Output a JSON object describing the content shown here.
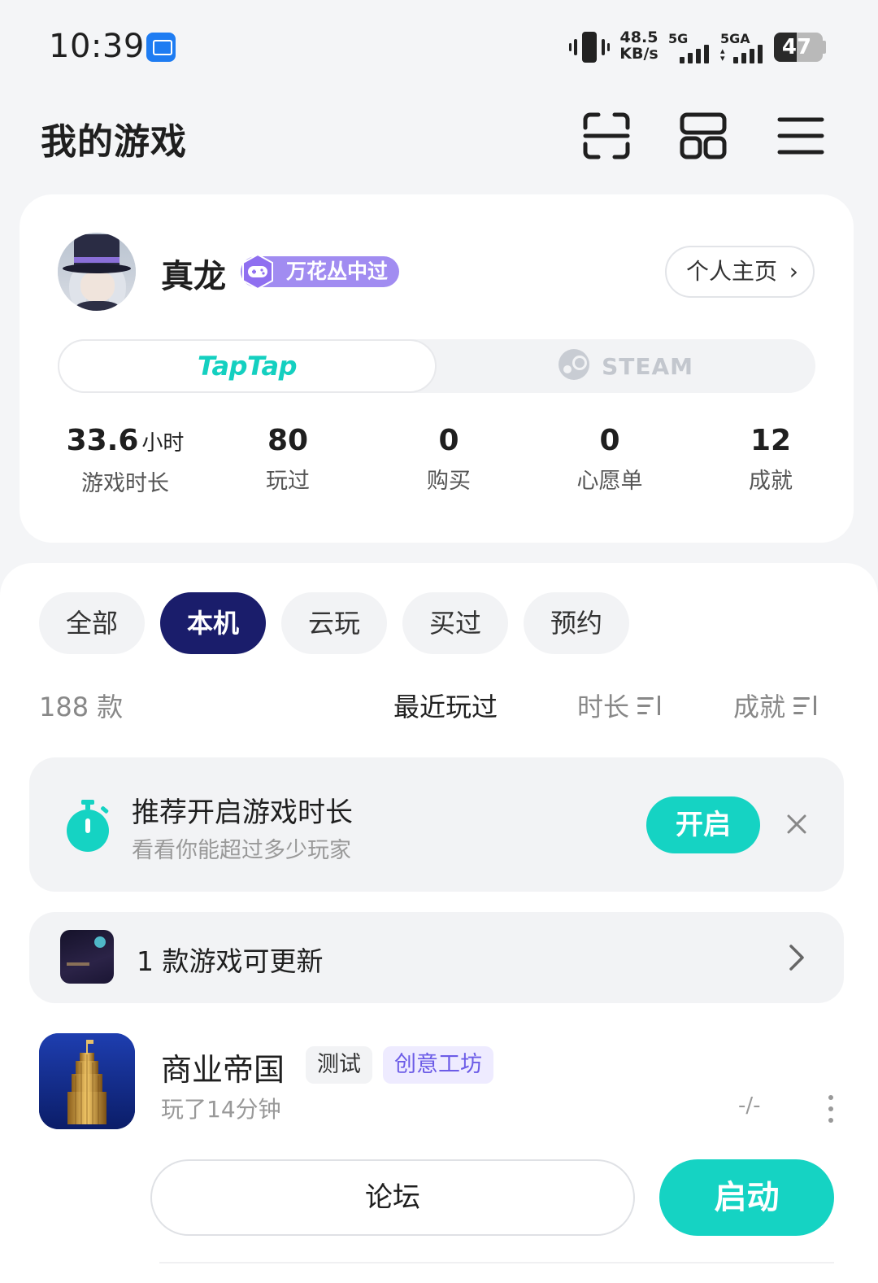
{
  "status_bar": {
    "time": "10:39",
    "net_speed_value": "48.5",
    "net_speed_unit": "KB/s",
    "signal1_label": "5G",
    "signal2_label": "5GA",
    "battery": "47"
  },
  "header": {
    "title": "我的游戏"
  },
  "profile": {
    "username": "真龙",
    "badge": "万花丛中过",
    "home_button": "个人主页",
    "platforms": [
      "TapTap",
      "STEAM"
    ],
    "active_platform": "TapTap",
    "stats": [
      {
        "value": "33.6",
        "unit": "小时",
        "label": "游戏时长"
      },
      {
        "value": "80",
        "unit": "",
        "label": "玩过"
      },
      {
        "value": "0",
        "unit": "",
        "label": "购买"
      },
      {
        "value": "0",
        "unit": "",
        "label": "心愿单"
      },
      {
        "value": "12",
        "unit": "",
        "label": "成就"
      }
    ]
  },
  "filters": {
    "chips": [
      "全部",
      "本机",
      "云玩",
      "买过",
      "预约"
    ],
    "active": "本机"
  },
  "list": {
    "count": "188 款",
    "sort_options": [
      "最近玩过",
      "时长",
      "成就"
    ],
    "active_sort": "最近玩过"
  },
  "recommendation": {
    "title": "推荐开启游戏时长",
    "subtitle": "看看你能超过多少玩家",
    "enable_label": "开启"
  },
  "update_notice": {
    "text": "1 款游戏可更新"
  },
  "game": {
    "name": "商业帝国",
    "tags": [
      "测试",
      "创意工坊"
    ],
    "playtime": "玩了14分钟",
    "score": "-/-",
    "forum_label": "论坛",
    "launch_label": "启动"
  },
  "colors": {
    "accent": "#15d3c3",
    "chip_active": "#1a1d6b",
    "badge": "#a18cf1"
  }
}
